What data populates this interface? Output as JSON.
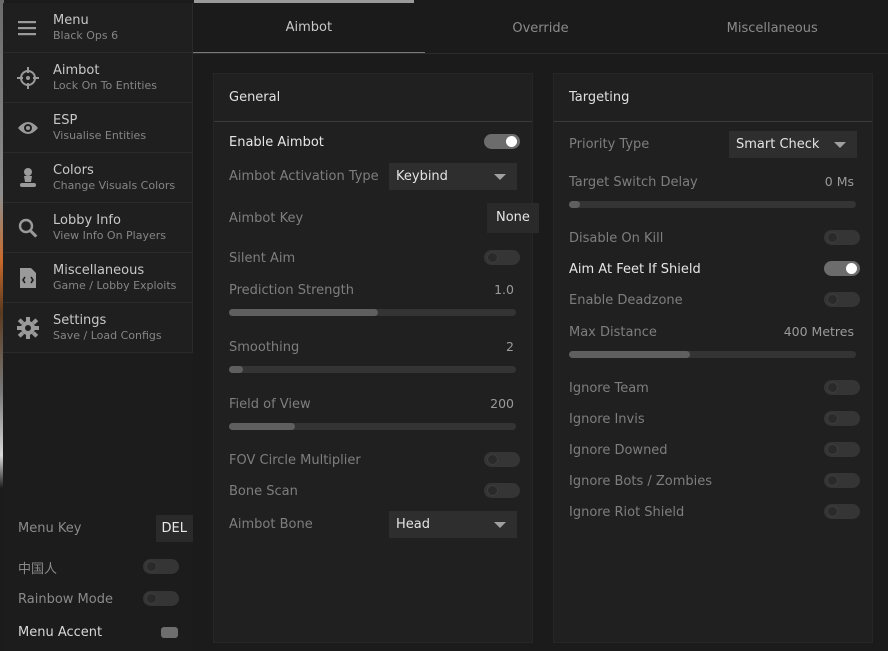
{
  "sidebar": {
    "items": [
      {
        "title": "Menu",
        "subtitle": "Black Ops 6",
        "icon": "hamburger-icon"
      },
      {
        "title": "Aimbot",
        "subtitle": "Lock On To Entities",
        "icon": "crosshair-icon"
      },
      {
        "title": "ESP",
        "subtitle": "Visualise Entities",
        "icon": "eye-icon"
      },
      {
        "title": "Colors",
        "subtitle": "Change Visuals Colors",
        "icon": "paint-bucket-icon"
      },
      {
        "title": "Lobby Info",
        "subtitle": "View Info On Players",
        "icon": "search-icon"
      },
      {
        "title": "Miscellaneous",
        "subtitle": "Game / Lobby Exploits",
        "icon": "code-file-icon"
      },
      {
        "title": "Settings",
        "subtitle": "Save / Load Configs",
        "icon": "gear-icon"
      }
    ],
    "menu_key_label": "Menu Key",
    "menu_key_value": "DEL",
    "chinese_label": "中国人",
    "chinese_on": false,
    "rainbow_label": "Rainbow Mode",
    "rainbow_on": false,
    "accent_label": "Menu Accent",
    "accent_color": "#6e6e6e"
  },
  "tabs": [
    {
      "label": "Aimbot",
      "active": true
    },
    {
      "label": "Override",
      "active": false
    },
    {
      "label": "Miscellaneous",
      "active": false
    }
  ],
  "general": {
    "title": "General",
    "enable_aimbot": {
      "label": "Enable Aimbot",
      "on": true
    },
    "activation_type": {
      "label": "Aimbot Activation Type",
      "value": "Keybind"
    },
    "aimbot_key": {
      "label": "Aimbot Key",
      "value": "None"
    },
    "silent_aim": {
      "label": "Silent Aim",
      "on": false
    },
    "prediction_strength": {
      "label": "Prediction Strength",
      "value": "1.0",
      "fraction": 0.52
    },
    "smoothing": {
      "label": "Smoothing",
      "value": "2",
      "fraction": 0.05
    },
    "field_of_view": {
      "label": "Field of View",
      "value": "200",
      "fraction": 0.23
    },
    "fov_circle_multiplier": {
      "label": "FOV Circle Multiplier",
      "on": false
    },
    "bone_scan": {
      "label": "Bone Scan",
      "on": false
    },
    "aimbot_bone": {
      "label": "Aimbot Bone",
      "value": "Head"
    }
  },
  "targeting": {
    "title": "Targeting",
    "priority_type": {
      "label": "Priority Type",
      "value": "Smart Check"
    },
    "target_switch_delay": {
      "label": "Target Switch Delay",
      "value": "0 Ms",
      "fraction": 0.0
    },
    "disable_on_kill": {
      "label": "Disable On Kill",
      "on": false
    },
    "aim_at_feet": {
      "label": "Aim At Feet If Shield",
      "on": true
    },
    "enable_deadzone": {
      "label": "Enable Deadzone",
      "on": false
    },
    "max_distance": {
      "label": "Max Distance",
      "value": "400 Metres",
      "fraction": 0.42
    },
    "ignore_team": {
      "label": "Ignore Team",
      "on": false
    },
    "ignore_invis": {
      "label": "Ignore Invis",
      "on": false
    },
    "ignore_downed": {
      "label": "Ignore Downed",
      "on": false
    },
    "ignore_bots": {
      "label": "Ignore Bots / Zombies",
      "on": false
    },
    "ignore_riot": {
      "label": "Ignore Riot Shield",
      "on": false
    }
  }
}
